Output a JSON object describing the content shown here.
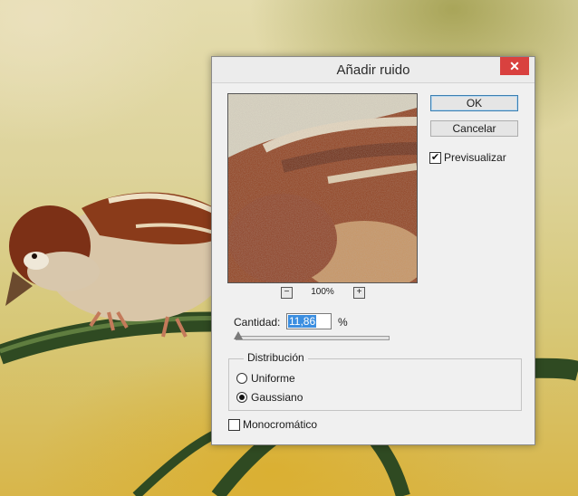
{
  "dialog": {
    "title": "Añadir ruido",
    "close_glyph": "✕",
    "ok_label": "OK",
    "cancel_label": "Cancelar",
    "preview_label": "Previsualizar",
    "preview_checked": true,
    "zoom_minus": "−",
    "zoom_plus": "+",
    "zoom_level": "100%",
    "amount_label": "Cantidad:",
    "amount_value": "11,86",
    "amount_unit": "%",
    "distribution_label": "Distribución",
    "uniform_label": "Uniforme",
    "gaussian_label": "Gaussiano",
    "selected_distribution": "Gaussiano",
    "monochrome_label": "Monocromático",
    "monochrome_checked": false,
    "checkmark_glyph": "✔"
  },
  "colors": {
    "close_button": "#d9413f",
    "selection": "#3b8ee0",
    "ok_border": "#3c7fb1"
  }
}
